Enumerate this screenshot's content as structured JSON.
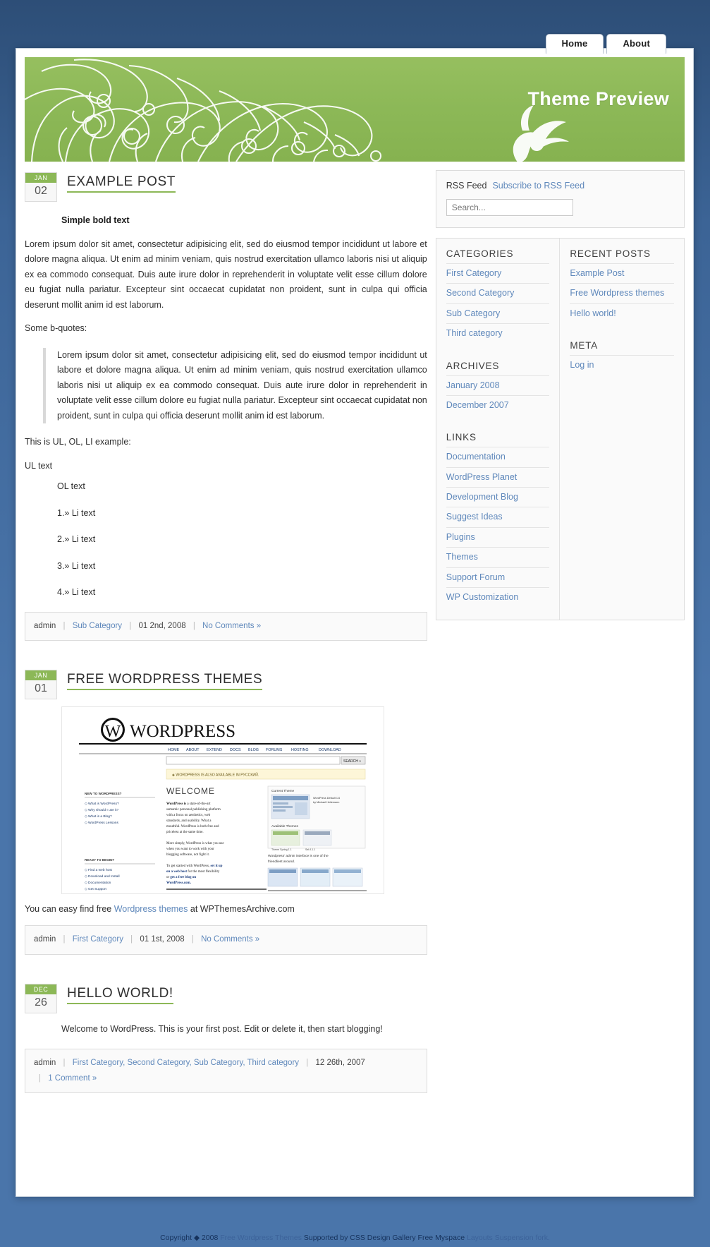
{
  "nav": {
    "tabs": [
      {
        "label": "Home",
        "active": true
      },
      {
        "label": "About",
        "active": false
      }
    ]
  },
  "header": {
    "title": "Theme Preview"
  },
  "posts": [
    {
      "date": {
        "month": "JAN",
        "day": "02"
      },
      "title": "EXAMPLE POST",
      "subtitle": "Simple bold text",
      "paragraph1": "Lorem ipsum dolor sit amet, consectetur adipisicing elit, sed do eiusmod tempor incididunt ut labore et dolore magna aliqua. Ut enim ad minim veniam, quis nostrud exercitation ullamco laboris nisi ut aliquip ex ea commodo consequat. Duis aute irure dolor in reprehenderit in voluptate velit esse cillum dolore eu fugiat nulla pariatur. Excepteur sint occaecat cupidatat non proident, sunt in culpa qui officia deserunt mollit anim id est laborum.",
      "quote_intro": "Some b-quotes:",
      "blockquote": "Lorem ipsum dolor sit amet, consectetur adipisicing elit, sed do eiusmod tempor incididunt ut labore et dolore magna aliqua. Ut enim ad minim veniam, quis nostrud exercitation ullamco laboris nisi ut aliquip ex ea commodo consequat. Duis aute irure dolor in reprehenderit in voluptate velit esse cillum dolore eu fugiat nulla pariatur. Excepteur sint occaecat cupidatat non proident, sunt in culpa qui officia deserunt mollit anim id est laborum.",
      "list_intro": "This is UL, OL, LI example:",
      "ul_item": "UL text",
      "ol_item": "OL text",
      "li_items": [
        "1.» Li text",
        "2.» Li text",
        "3.» Li text",
        "4.» Li text"
      ],
      "meta": {
        "author": "admin",
        "categories": "Sub Category",
        "date": "01 2nd, 2008",
        "comments": "No Comments »"
      }
    },
    {
      "date": {
        "month": "JAN",
        "day": "01"
      },
      "title": "FREE WORDPRESS THEMES",
      "caption_prefix": "You can easy find free ",
      "caption_link": "Wordpress themes",
      "caption_suffix": " at WPThemesArchive.com",
      "meta": {
        "author": "admin",
        "categories": "First Category",
        "date": "01 1st, 2008",
        "comments": "No Comments »"
      }
    },
    {
      "date": {
        "month": "DEC",
        "day": "26"
      },
      "title": "HELLO WORLD!",
      "paragraph1": "Welcome to WordPress. This is your first post. Edit or delete it, then start blogging!",
      "meta": {
        "author": "admin",
        "categories": "First Category, Second Category, Sub Category, Third category",
        "date": "12 26th, 2007",
        "comments": "1 Comment »"
      }
    }
  ],
  "sidebar": {
    "rss_label": "RSS Feed",
    "rss_link": "Subscribe to RSS Feed",
    "search_placeholder": "Search...",
    "widgets": {
      "categories": {
        "title": "CATEGORIES",
        "items": [
          "First Category",
          "Second Category",
          "Sub Category",
          "Third category"
        ]
      },
      "archives": {
        "title": "ARCHIVES",
        "items": [
          "January 2008",
          "December 2007"
        ]
      },
      "links": {
        "title": "LINKS",
        "items": [
          "Documentation",
          "WordPress Planet",
          "Development Blog",
          "Suggest Ideas",
          "Plugins",
          "Themes",
          "Support Forum",
          "WP Customization"
        ]
      },
      "recent_posts": {
        "title": "RECENT POSTS",
        "items": [
          "Example Post",
          "Free Wordpress themes",
          "Hello world!"
        ]
      },
      "meta": {
        "title": "META",
        "items": [
          "Log in"
        ]
      }
    }
  },
  "footer": {
    "part1": "Copyright ",
    "symbol": "◆",
    "part2": " 2008 ",
    "link1": "Free Wordpress Themes",
    "part3": " Supported by ",
    "link2": "CSS Design Gallery",
    "part4": " Free Myspace ",
    "link3": "Layouts Suspension fork."
  },
  "post_image": {
    "brand": "WordPress",
    "navitems": [
      "HOME",
      "ABOUT",
      "EXTEND",
      "DOCS",
      "BLOG",
      "FORUMS",
      "HOSTING",
      "DOWNLOAD"
    ],
    "search_button": "SEARCH »",
    "notice": "WORDPRESS IS ALSO AVAILABLE IN РУССКИЙ.",
    "welcome": "WELCOME",
    "p1_strong": "WordPress is",
    "p1": " a state-of-the-art semantic personal publishing platform with a focus on aesthetics, web standards, and usability. What a mouthful. WordPress is both free and priceless at the same time.",
    "p2": "More simply, WordPress is what you use when you want to work with your blogging software, not fight it.",
    "p3_pre": "To get started with WordPress, ",
    "p3_link1": "set it up on a web host",
    "p3_mid": " for the most flexibility or ",
    "p3_link2": "get a free blog on WordPress.com.",
    "col_head1": "NEW TO WORDPRESS?",
    "col_links1": [
      "What is WordPress?",
      "Why should I use it?",
      "What is a Blog?",
      "WordPress Lessons"
    ],
    "col_head2": "READY TO BEGIN?",
    "col_links2": [
      "Find a web host",
      "Download and Install",
      "Documentation",
      "Get Support"
    ],
    "right_head1": "Current Theme",
    "right_head2": "Available Themes",
    "right_caption": "Wordpress' admin interface is one of the friendliest around.",
    "right_meta1": "WordPress Default 1.6 by Michael Heilemann",
    "right_meta2": "Theme Spring 1.1",
    "right_meta3": "Sel A 1.1"
  }
}
